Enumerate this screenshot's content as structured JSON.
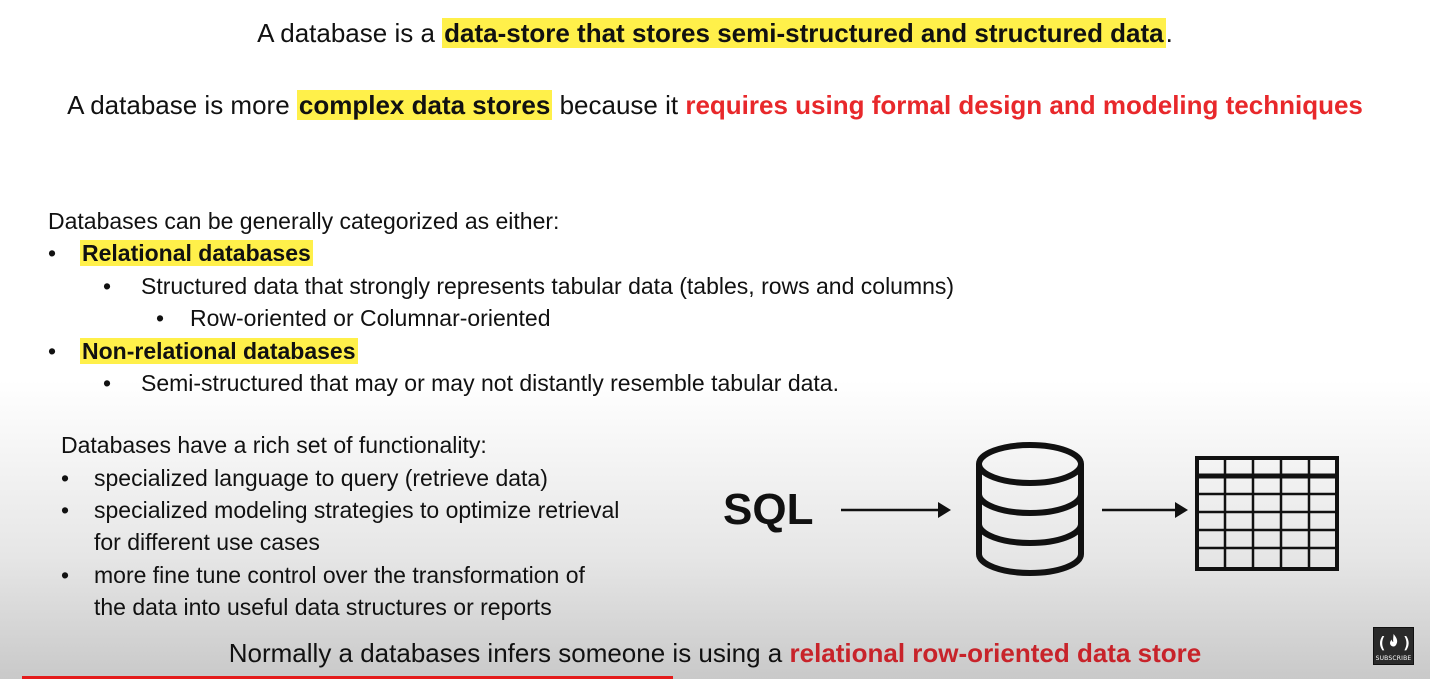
{
  "headline1": {
    "prefix": "A database is a ",
    "highlight": "data-store that stores semi-structured and structured data",
    "suffix": "."
  },
  "headline2": {
    "prefix": "A database is more ",
    "highlight": "complex data stores",
    "middle": " because it ",
    "emphasis": "requires using formal design and modeling techniques"
  },
  "categories": {
    "intro": "Databases can be generally categorized as either:",
    "relational": {
      "label": "Relational databases",
      "detail": "Structured data that strongly represents tabular data (tables, rows and columns)",
      "subdetail": "Row-oriented or Columnar-oriented"
    },
    "nonrelational": {
      "label": "Non-relational databases",
      "detail": "Semi-structured that may or may not distantly resemble tabular data."
    }
  },
  "functionality": {
    "intro": "Databases have a rich set of functionality:",
    "item1": "specialized language to query (retrieve data)",
    "item2a": "specialized modeling strategies to optimize retrieval",
    "item2b": "for different use cases",
    "item3a": "more fine tune control over the transformation of",
    "item3b": "the data into useful data structures or reports"
  },
  "diagram": {
    "sql_label": "SQL",
    "icons": [
      "database-cylinder-icon",
      "table-grid-icon"
    ]
  },
  "bottom": {
    "prefix": "Normally a databases infers someone is using a ",
    "emphasis": "relational row-oriented data store"
  },
  "logo": {
    "caption": "SUBSCRIBE"
  },
  "video_progress_fraction": 0.455,
  "colors": {
    "highlight": "#fff04a",
    "red_emphasis": "#e8282b",
    "progress": "#e41b1b"
  }
}
